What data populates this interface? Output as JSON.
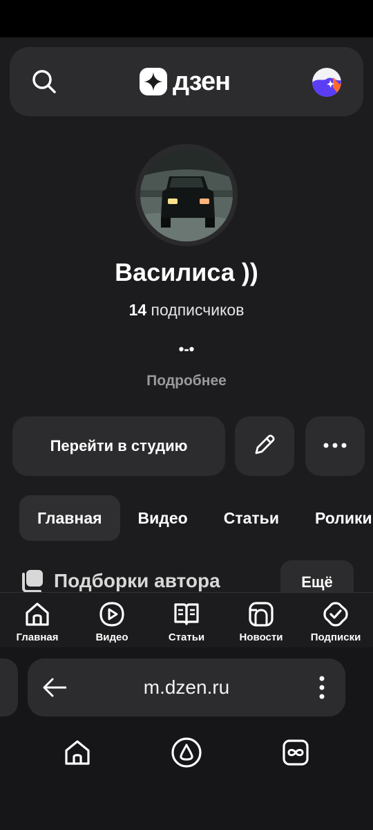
{
  "header": {
    "logo_text": "дзен",
    "search_icon": "search-icon",
    "avatar_icon": "user-avatar"
  },
  "profile": {
    "name": "Василиса ))",
    "subscribers_count": "14",
    "subscribers_label": "подписчиков",
    "description": "•-•",
    "more_link": "Подробнее"
  },
  "actions": {
    "studio_label": "Перейти в студию",
    "edit_icon": "pencil-icon",
    "more_icon": "more-horizontal-icon"
  },
  "tabs": [
    {
      "label": "Главная",
      "active": true
    },
    {
      "label": "Видео",
      "active": false
    },
    {
      "label": "Статьи",
      "active": false
    },
    {
      "label": "Ролики",
      "active": false
    }
  ],
  "section": {
    "title": "Подборки автора",
    "more_label": "Ещё"
  },
  "app_nav": [
    {
      "label": "Главная",
      "icon": "home-icon"
    },
    {
      "label": "Видео",
      "icon": "video-icon"
    },
    {
      "label": "Статьи",
      "icon": "articles-icon"
    },
    {
      "label": "Новости",
      "icon": "news-icon"
    },
    {
      "label": "Подписки",
      "icon": "subscriptions-icon"
    }
  ],
  "browser": {
    "url": "m.dzen.ru"
  },
  "colors": {
    "background": "#1c1c1e",
    "surface": "#2c2c2e",
    "muted_text": "#9a9a9e"
  }
}
